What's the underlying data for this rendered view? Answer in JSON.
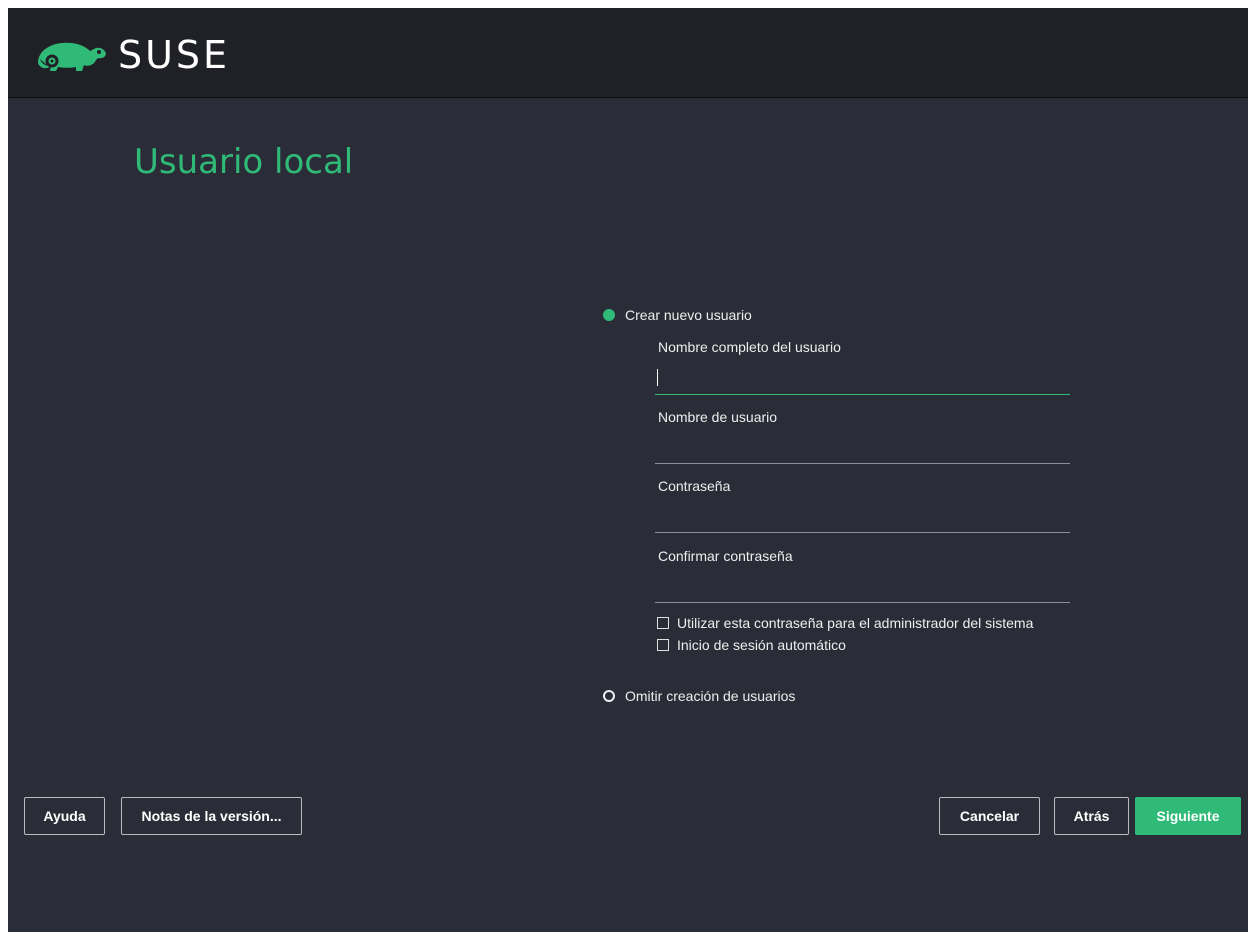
{
  "header": {
    "logo_text": "SUSE",
    "logo_icon": "chameleon-icon",
    "brand_color": "#30ba78"
  },
  "page": {
    "title": "Usuario local"
  },
  "options": {
    "create_user": {
      "label": "Crear nuevo usuario",
      "selected": true
    },
    "skip_user": {
      "label": "Omitir creación de usuarios",
      "selected": false
    }
  },
  "form": {
    "full_name": {
      "label": "Nombre completo del usuario",
      "value": "",
      "focused": true
    },
    "username": {
      "label": "Nombre de usuario",
      "value": ""
    },
    "password": {
      "label": "Contraseña",
      "value": ""
    },
    "confirm_password": {
      "label": "Confirmar contraseña",
      "value": ""
    },
    "use_for_admin": {
      "label": "Utilizar esta contraseña para el administrador del sistema",
      "checked": false
    },
    "autologin": {
      "label": "Inicio de sesión automático",
      "checked": false
    }
  },
  "footer": {
    "help_label": "Ayuda",
    "release_notes_label": "Notas de la versión...",
    "cancel_label": "Cancelar",
    "back_label": "Atrás",
    "next_label": "Siguiente"
  }
}
